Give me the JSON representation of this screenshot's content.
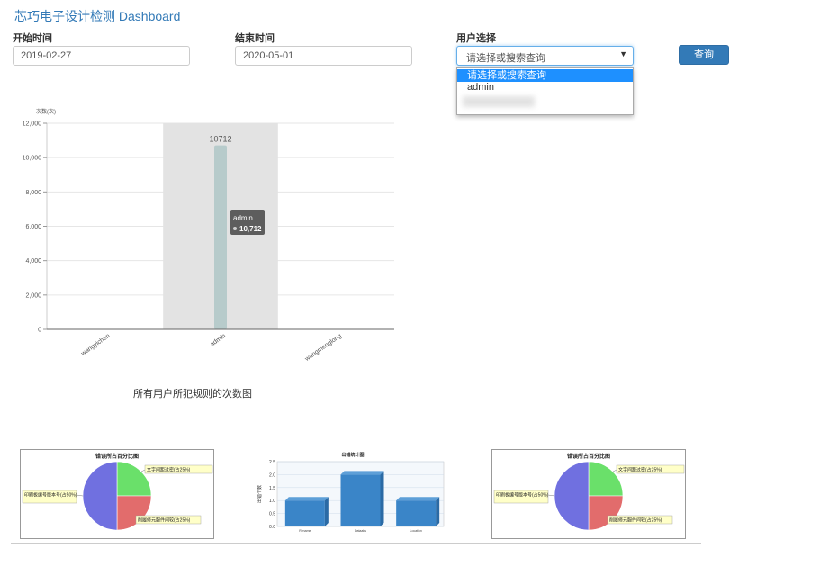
{
  "brand": "芯巧电子设计检测 Dashboard",
  "filters": {
    "start_label": "开始时间",
    "start_value": "2019-02-27",
    "end_label": "结束时间",
    "end_value": "2020-05-01",
    "user_label": "用户选择",
    "user_selected": "请选择或搜索查询",
    "user_options": [
      "请选择或搜索查询",
      "admin"
    ]
  },
  "query_button": "查询",
  "main_caption": "所有用户所犯规则的次数图",
  "chart_data": [
    {
      "type": "bar",
      "ylabel": "次数(次)",
      "categories": [
        "wangyichen",
        "admin",
        "wangmenglong"
      ],
      "values": [
        0,
        10712,
        0
      ],
      "ylim": [
        0,
        12000
      ],
      "yticks": [
        "0",
        "2,000",
        "4,000",
        "6,000",
        "8,000",
        "10,000",
        "12,000"
      ],
      "data_labels": [
        "10712"
      ],
      "tooltip": {
        "title": "admin",
        "value": "10,712"
      },
      "bar_color": "#b7cbcb"
    },
    {
      "type": "pie",
      "title": "错误所占百分比图",
      "slices": [
        {
          "label": "文字间距过密(占25%)",
          "value": 25,
          "color": "#6ae06a"
        },
        {
          "label": "削履修元服件间较(占25%)",
          "value": 25,
          "color": "#e26c6c"
        },
        {
          "label": "印刷板编号版本号(占50%)",
          "value": 50,
          "color": "#7070e0"
        }
      ]
    },
    {
      "type": "bar",
      "title": "出错统计图",
      "ylabel": "出错个数",
      "categories": [
        "Rename",
        "Dataabs",
        "Location"
      ],
      "values": [
        1,
        2,
        1
      ],
      "ylim": [
        0,
        2.5
      ],
      "yticks": [
        "0.0",
        "0.5",
        "1.0",
        "1.5",
        "2.0",
        "2.5"
      ],
      "bar_color": "#3a85c8"
    },
    {
      "type": "pie",
      "title": "错误所占百分比图",
      "slices": [
        {
          "label": "文字间距过密(占25%)",
          "value": 25,
          "color": "#6ae06a"
        },
        {
          "label": "削履修元服件间较(占25%)",
          "value": 25,
          "color": "#e26c6c"
        },
        {
          "label": "印刷板编号版本号(占50%)",
          "value": 50,
          "color": "#7070e0"
        }
      ]
    }
  ]
}
